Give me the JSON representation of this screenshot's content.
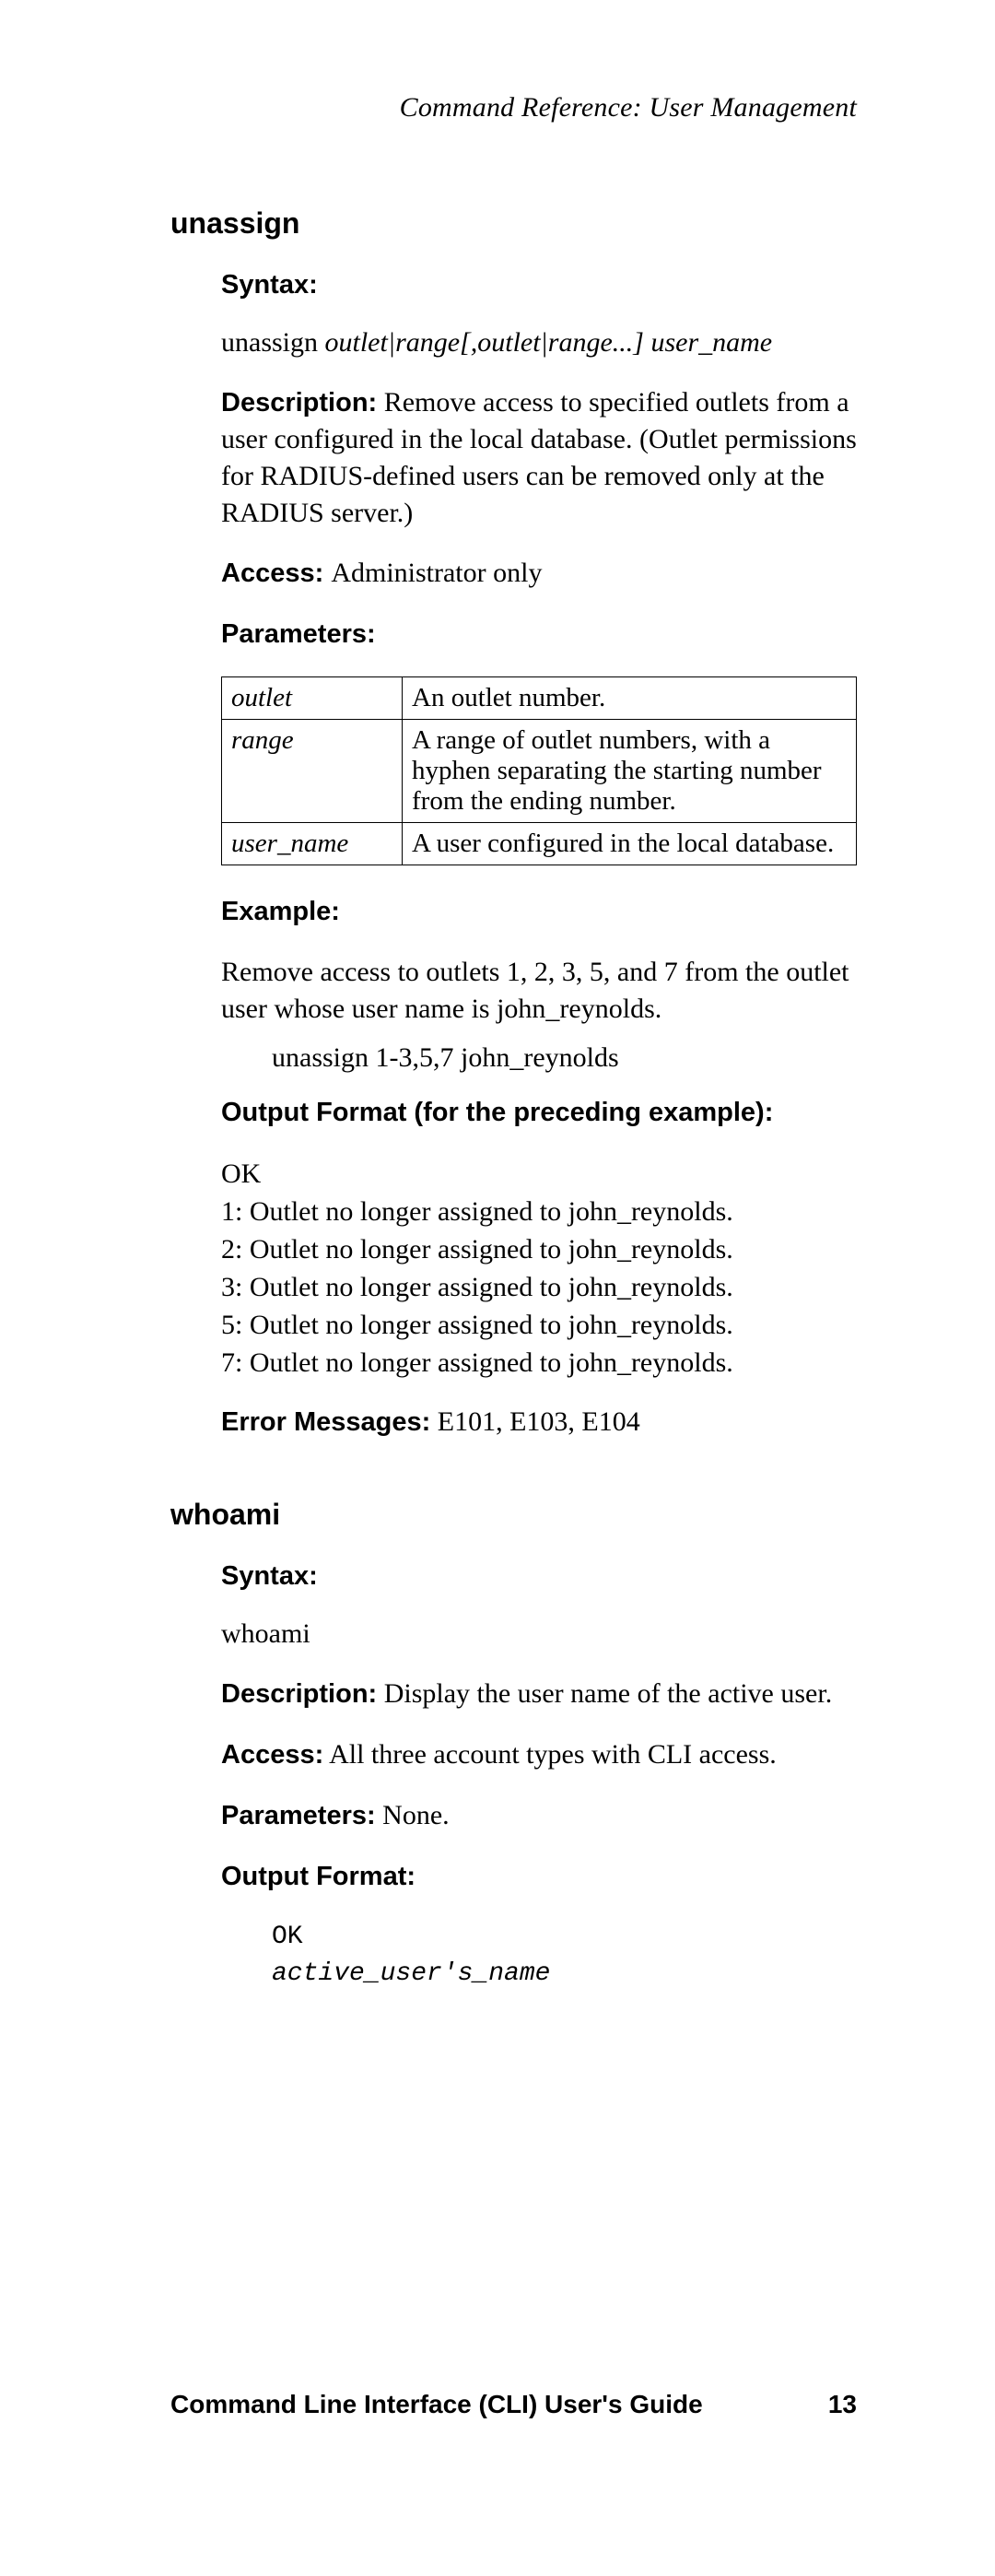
{
  "header": "Command Reference: User Management",
  "cmd1": {
    "name": "unassign",
    "syntax_label": "Syntax:",
    "syntax_cmd": "unassign",
    "syntax_args": " outlet|range[,outlet|range...] user_name",
    "description_label": "Description:",
    "description_text": " Remove access to specified outlets from a user configured in the local database. (Outlet permissions for RADIUS-defined users can be removed only at the RADIUS server.)",
    "access_label": "Access: ",
    "access_text": " Administrator only",
    "parameters_label": "Parameters:",
    "params": [
      {
        "name": "outlet",
        "desc": "An outlet number."
      },
      {
        "name": "range",
        "desc": "A range of outlet numbers, with a hyphen separating the starting number from the ending number."
      },
      {
        "name": "user_name",
        "desc": "A user configured in the local database."
      }
    ],
    "example_label": "Example:",
    "example_text": "Remove access to outlets 1, 2, 3, 5, and 7 from the outlet user whose user name is john_reynolds.",
    "example_cmd": "unassign 1-3,5,7 john_reynolds",
    "output_label": "Output Format (for the preceding example):",
    "output_lines": [
      "OK",
      "1: Outlet no longer assigned to john_reynolds.",
      "2: Outlet no longer assigned to john_reynolds.",
      "3: Outlet no longer assigned to john_reynolds.",
      "5: Outlet no longer assigned to john_reynolds.",
      "7: Outlet no longer assigned to john_reynolds."
    ],
    "errors_label": "Error Messages:",
    "errors_text": " E101, E103, E104"
  },
  "cmd2": {
    "name": "whoami",
    "syntax_label": "Syntax:",
    "syntax_text": "whoami",
    "description_label": "Description:",
    "description_text": " Display the user name of the active user.",
    "access_label": "Access:",
    "access_text": " All three account types with CLI access.",
    "parameters_label": "Parameters:",
    "parameters_text": " None.",
    "output_label": "Output Format:",
    "output_mono_1": "OK",
    "output_mono_2": "active_user's_name"
  },
  "footer": {
    "title": "Command Line Interface (CLI) User's Guide",
    "page": "13"
  }
}
